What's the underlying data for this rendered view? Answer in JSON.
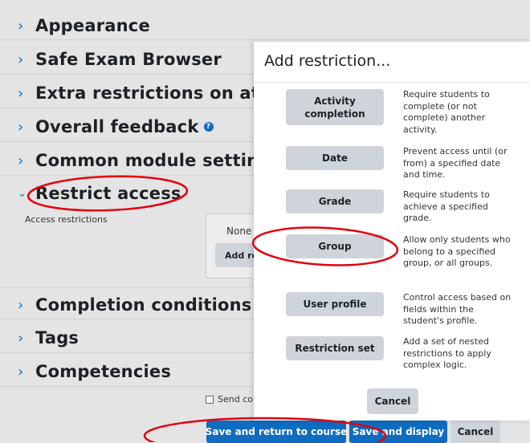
{
  "sections": [
    {
      "label": "Appearance",
      "help": false
    },
    {
      "label": "Safe Exam Browser",
      "help": false
    },
    {
      "label": "Extra restrictions on attem",
      "help": false
    },
    {
      "label": "Overall feedback",
      "help": true
    },
    {
      "label": "Common module settings",
      "help": false
    },
    {
      "label": "Restrict access",
      "help": false,
      "expanded": true
    },
    {
      "label": "Completion conditions",
      "help": false
    },
    {
      "label": "Tags",
      "help": false
    },
    {
      "label": "Competencies",
      "help": false
    }
  ],
  "icons": {
    "collapsed": "chevron-right-icon",
    "expanded": "chevron-down-icon",
    "help": "help-icon"
  },
  "restrict": {
    "field_label": "Access restrictions",
    "none_text": "None",
    "add_button": "Add re"
  },
  "send_label": "Send co",
  "footer": {
    "save_return": "Save and return to course",
    "save_display": "Save and display",
    "cancel": "Cancel"
  },
  "modal": {
    "title": "Add restriction...",
    "options": [
      {
        "label": "Activity completion",
        "desc": "Require students to complete (or not complete) another activity."
      },
      {
        "label": "Date",
        "desc": "Prevent access until (or from) a specified date and time."
      },
      {
        "label": "Grade",
        "desc": "Require students to achieve a specified grade."
      },
      {
        "label": "Group",
        "desc": "Allow only students who belong to a specified group, or all groups."
      },
      {
        "label": "User profile",
        "desc": "Control access based on fields within the student's profile."
      },
      {
        "label": "Restriction set",
        "desc": "Add a set of nested restrictions to apply complex logic."
      }
    ],
    "cancel": "Cancel"
  },
  "colors": {
    "primary": "#0f6cbf",
    "secondary": "#ced4da",
    "annotation": "#e3000f"
  }
}
